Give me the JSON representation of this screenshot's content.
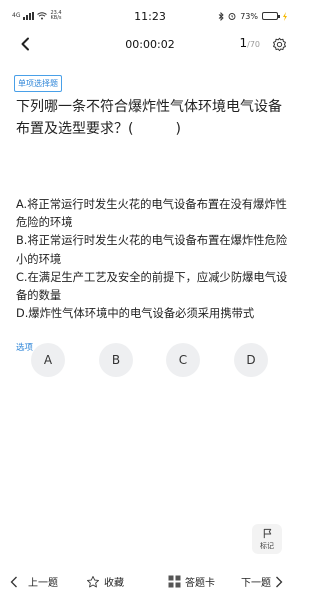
{
  "status_bar": {
    "network": "4G",
    "speed": "23.4",
    "speed_unit": "KB/s",
    "time": "11:23",
    "battery_percent": "73%",
    "battery_level": 0.73
  },
  "header": {
    "timer": "00:00:02",
    "current": "1",
    "total": "/70"
  },
  "question": {
    "type_badge": "单项选择题",
    "text": "下列哪一条不符合爆炸性气体环境电气设备布置及选型要求？(　　　)",
    "options": [
      "A.将正常运行时发生火花的电气设备布置在没有爆炸性危险的环境",
      "B.将正常运行时发生火花的电气设备布置在爆炸性危险小的环境",
      "C.在满足生产工艺及安全的前提下，应减少防爆电气设备的数量",
      "D.爆炸性气体环境中的电气设备必须采用携带式"
    ],
    "options_label": "选项",
    "answer_buttons": [
      "A",
      "B",
      "C",
      "D"
    ]
  },
  "mark": {
    "label": "标记"
  },
  "bottom_bar": {
    "prev_label": "上一题",
    "favorite_label": "收藏",
    "answer_card_label": "答题卡",
    "next_label": "下一题"
  }
}
